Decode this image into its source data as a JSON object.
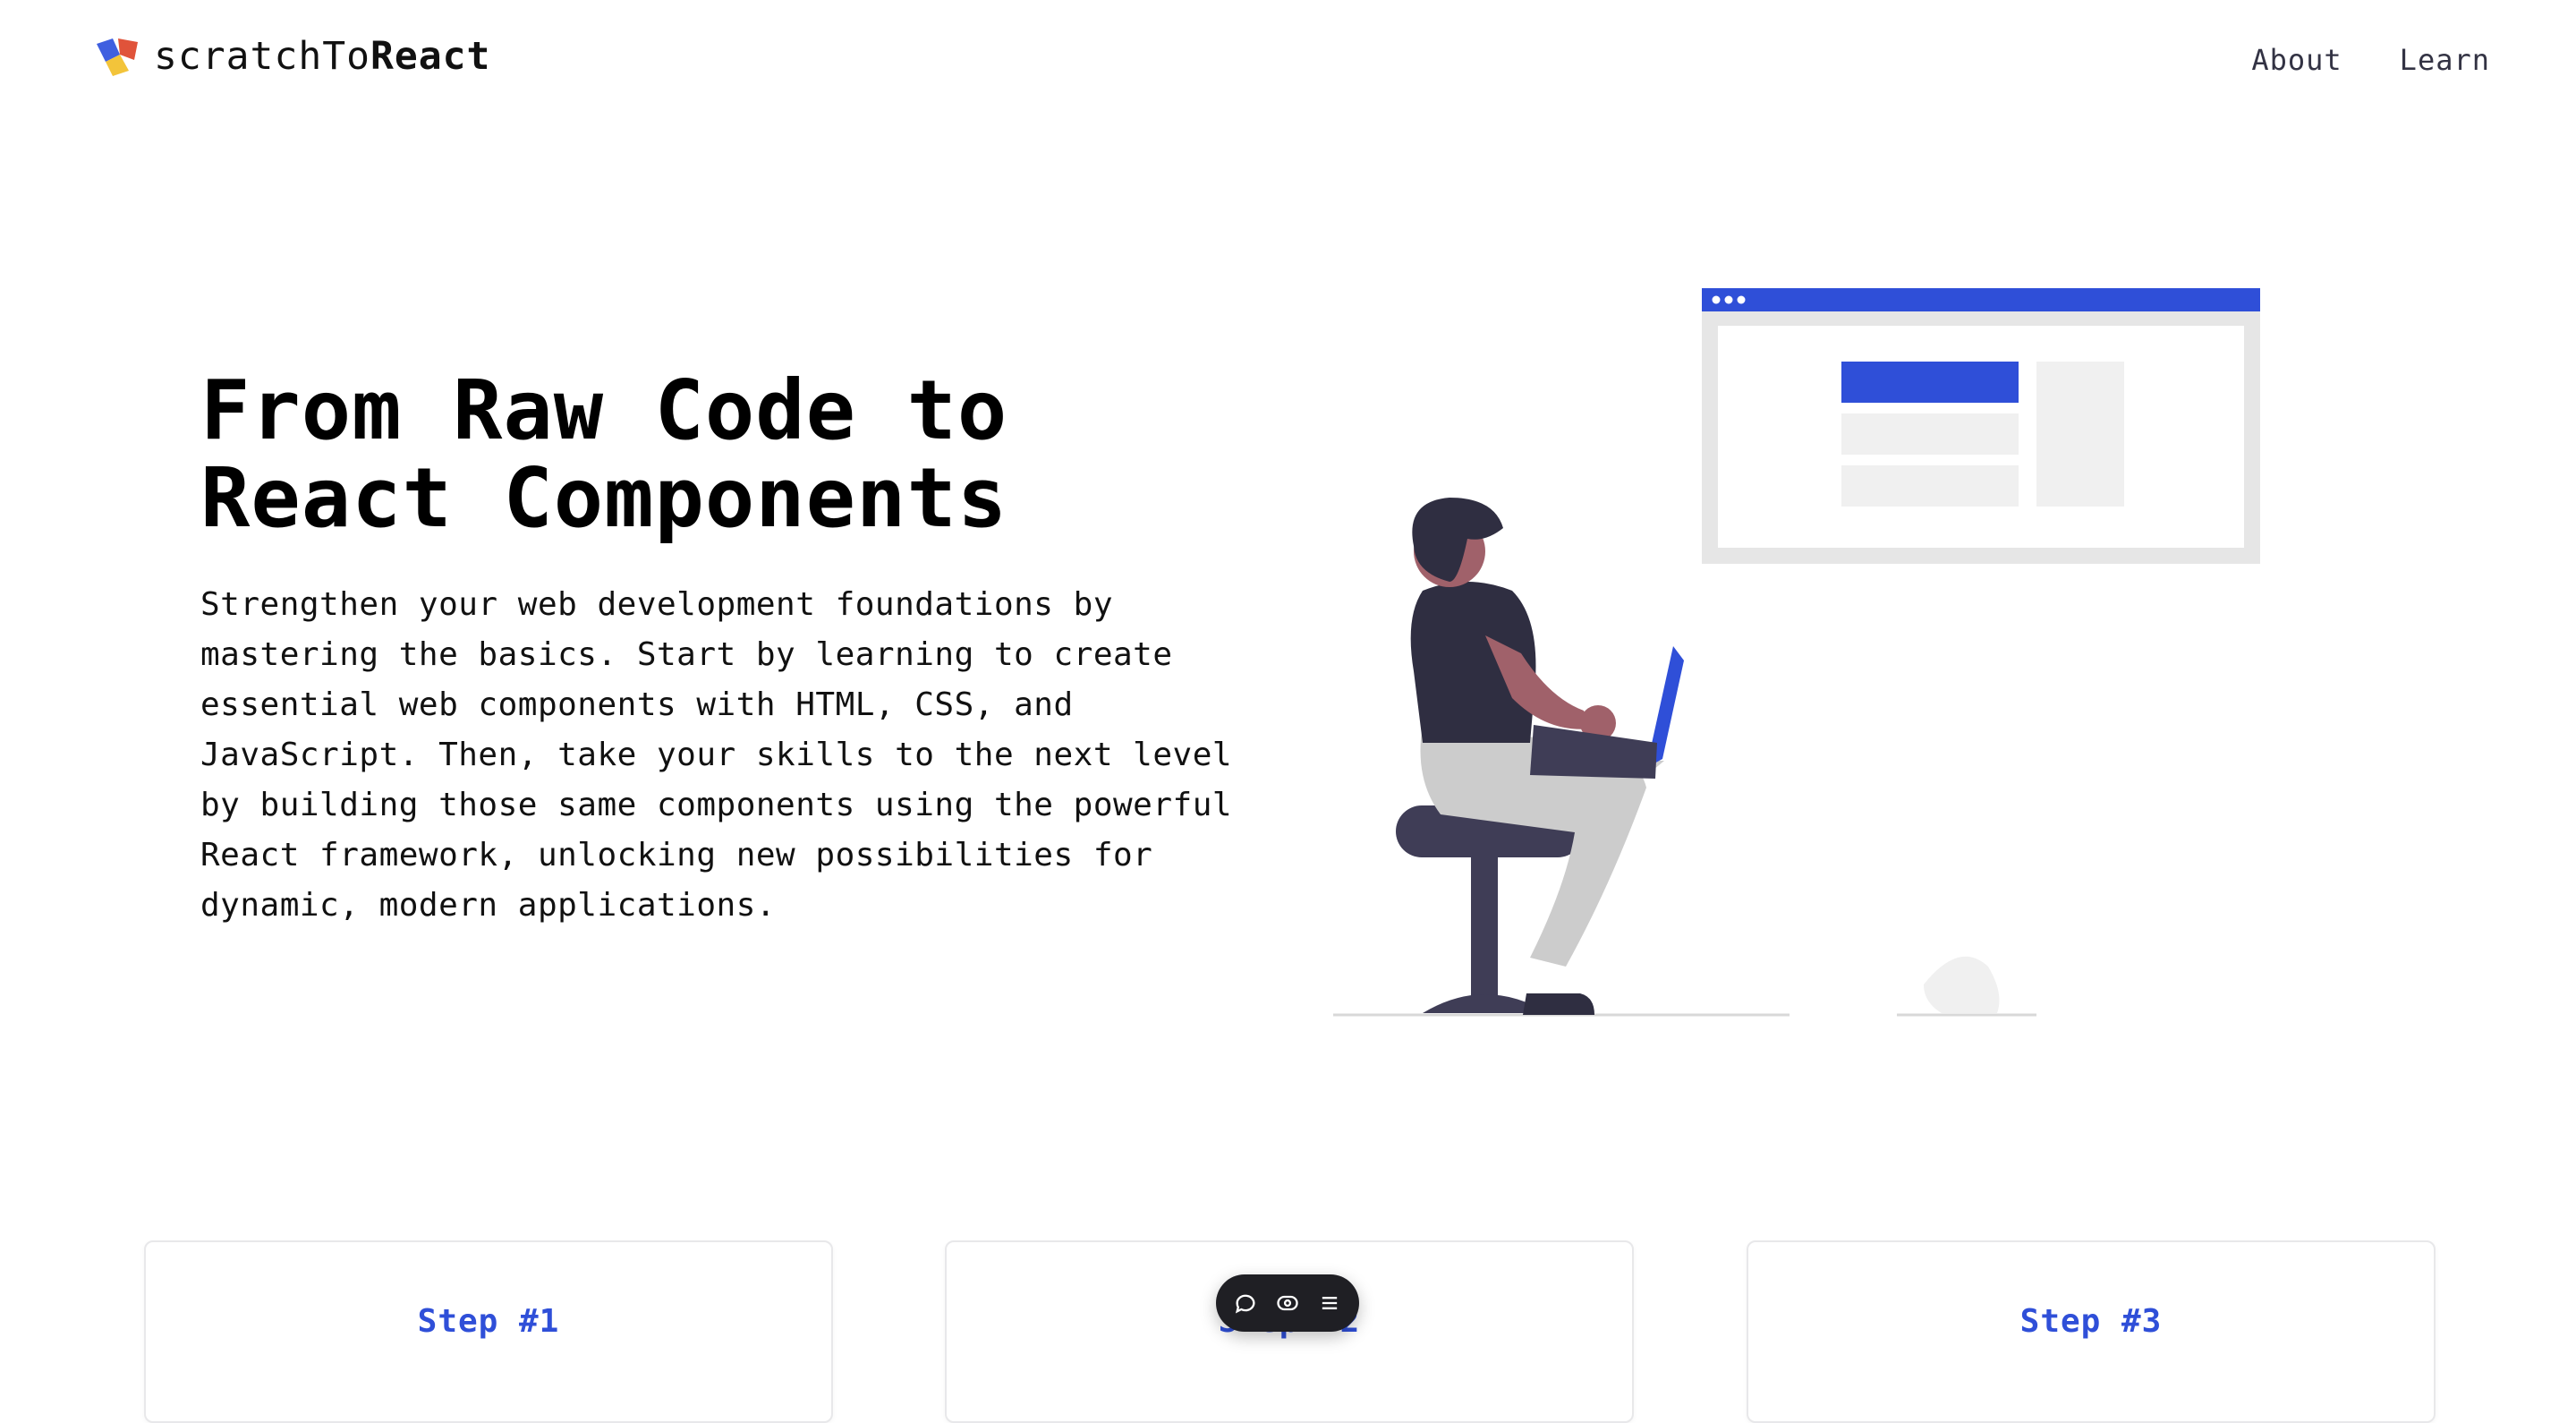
{
  "header": {
    "logo_text_light": "scratchTo",
    "logo_text_bold": "React",
    "nav": {
      "about": "About",
      "learn": "Learn"
    }
  },
  "hero": {
    "title_line1": "From Raw Code to",
    "title_line2": "React Components",
    "description": "Strengthen your web development foundations by mastering the basics. Start by learning to create essential web components with HTML, CSS, and JavaScript. Then, take your skills to the next level by building those same components using the powerful React framework, unlocking new possibilities for dynamic, modern applications."
  },
  "steps": [
    {
      "label": "Step #1"
    },
    {
      "label": "Step #2"
    },
    {
      "label": "Step #3"
    }
  ],
  "toolbar": {
    "icons": [
      "comment-icon",
      "eye-icon",
      "menu-icon"
    ]
  },
  "colors": {
    "accent": "#2f4fd8",
    "logo_blue": "#3f5fe0",
    "logo_red": "#e0533a",
    "logo_yellow": "#f3c43a"
  }
}
